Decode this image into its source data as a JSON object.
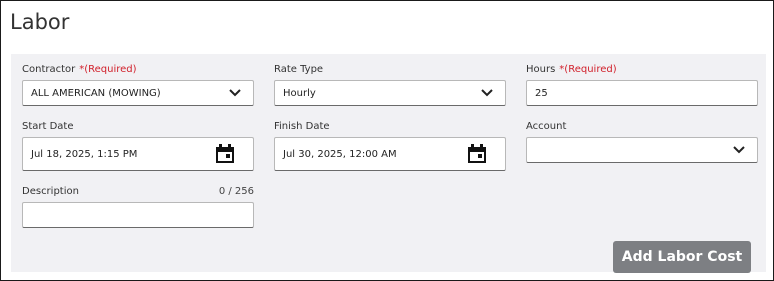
{
  "title": "Labor",
  "fields": {
    "contractor": {
      "label": "Contractor",
      "required": "*(Required)",
      "value": "ALL AMERICAN (MOWING)",
      "icon": "chevron-down-icon"
    },
    "rate_type": {
      "label": "Rate Type",
      "value": "Hourly",
      "icon": "chevron-down-icon"
    },
    "hours": {
      "label": "Hours",
      "required": "*(Required)",
      "value": "25"
    },
    "start_date": {
      "label": "Start Date",
      "value": "Jul 18, 2025, 1:15 PM",
      "icon": "calendar-icon"
    },
    "finish_date": {
      "label": "Finish Date",
      "value": "Jul 30, 2025, 12:00 AM",
      "icon": "calendar-icon"
    },
    "account": {
      "label": "Account",
      "value": "",
      "icon": "chevron-down-icon"
    },
    "description": {
      "label": "Description",
      "counter": "0 / 256",
      "value": ""
    }
  },
  "actions": {
    "add_label": "Add Labor Cost"
  },
  "colors": {
    "required": "#d11f2a",
    "panel": "#f1f1f4",
    "button": "#7d7f83"
  }
}
